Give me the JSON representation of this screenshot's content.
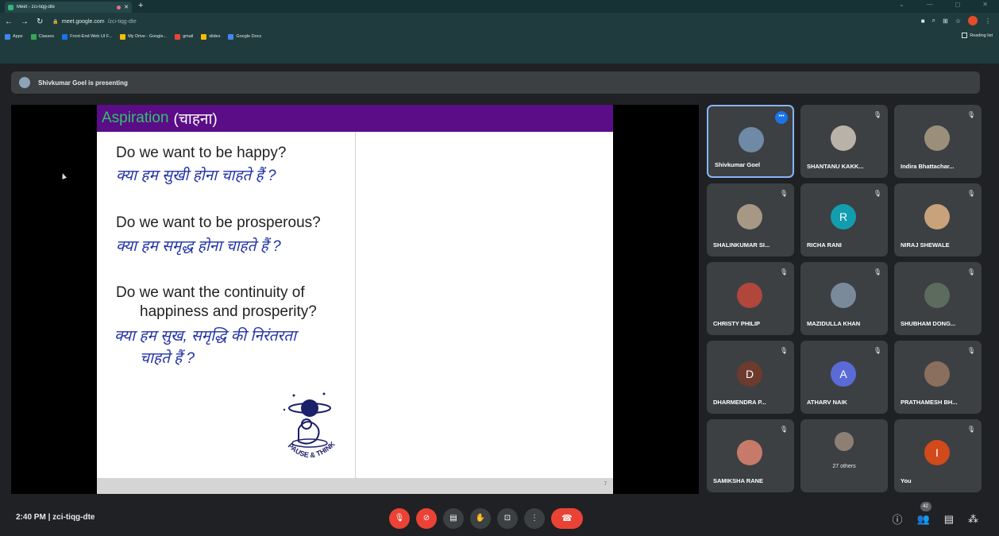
{
  "browser": {
    "tab_title": "Meet - zci-tiqg-dte",
    "url_host": "meet.google.com",
    "url_path": "/zci-tiqg-dte",
    "bookmarks": [
      {
        "label": "Apps",
        "color": "#4285f4"
      },
      {
        "label": "Classes",
        "color": "#34a853"
      },
      {
        "label": "Front-End Web UI F...",
        "color": "#1a73e8"
      },
      {
        "label": "My Drive - Google...",
        "color": "#fbbc04"
      },
      {
        "label": "gmail",
        "color": "#ea4335"
      },
      {
        "label": "slides",
        "color": "#fbbc04"
      },
      {
        "label": "Google Docs",
        "color": "#4285f4"
      }
    ],
    "reading_list": "Reading list"
  },
  "meet": {
    "presenting_banner": "Shivkumar Goel is presenting",
    "slide": {
      "title_en": "Aspiration",
      "title_hi": "(चाहना)",
      "q1_en": "Do we want to be happy?",
      "q1_hi": "क्या हम सुखी होना चाहते हैं ?",
      "q2_en": "Do we want to be prosperous?",
      "q2_hi": "क्या हम समृद्ध होना चाहते हैं ?",
      "q3_en_line1": "Do we want the continuity of",
      "q3_en_line2": "happiness and prosperity?",
      "q3_hi_line1": "क्या हम सुख, समृद्धि की निरंतरता",
      "q3_hi_line2": "चाहते हैं ?",
      "logo_text": "PAUSE & THINK",
      "page_number": "7"
    },
    "tiles": [
      {
        "name": "Shivkumar Goel",
        "kind": "photo",
        "color": "#6f8aa6",
        "active": true
      },
      {
        "name": "SHANTANU KAKK...",
        "kind": "photo",
        "color": "#b9b2a8"
      },
      {
        "name": "Indira Bhattachar...",
        "kind": "photo",
        "color": "#9b8f7c"
      },
      {
        "name": "SHALINKUMAR SI...",
        "kind": "photo",
        "color": "#a79886"
      },
      {
        "name": "RICHA RANI",
        "kind": "letter",
        "letter": "R",
        "color": "#129eaf"
      },
      {
        "name": "NIRAJ SHEWALE",
        "kind": "photo",
        "color": "#c8a27a"
      },
      {
        "name": "CHRISTY PHILIP",
        "kind": "photo",
        "color": "#b0463c"
      },
      {
        "name": "MAZIDULLA KHAN",
        "kind": "photo",
        "color": "#7a8a9b"
      },
      {
        "name": "SHUBHAM DONG...",
        "kind": "photo",
        "color": "#5c6b5e"
      },
      {
        "name": "DHARMENDRA P...",
        "kind": "letter",
        "letter": "D",
        "color": "#6d3a2e"
      },
      {
        "name": "ATHARV NAIK",
        "kind": "letter",
        "letter": "A",
        "color": "#5a6bd8"
      },
      {
        "name": "PRATHAMESH BH...",
        "kind": "photo",
        "color": "#8a6f5f"
      },
      {
        "name": "SAMIKSHA RANE",
        "kind": "photo",
        "color": "#c87a6a"
      },
      {
        "name": "27 others",
        "kind": "others",
        "color": "#8d7f73"
      },
      {
        "name": "You",
        "kind": "letter",
        "letter": "I",
        "color": "#d04a1c"
      }
    ],
    "time": "2:40 PM",
    "separator": "|",
    "meeting_code": "zci-tiqg-dte",
    "participant_count": "42"
  }
}
